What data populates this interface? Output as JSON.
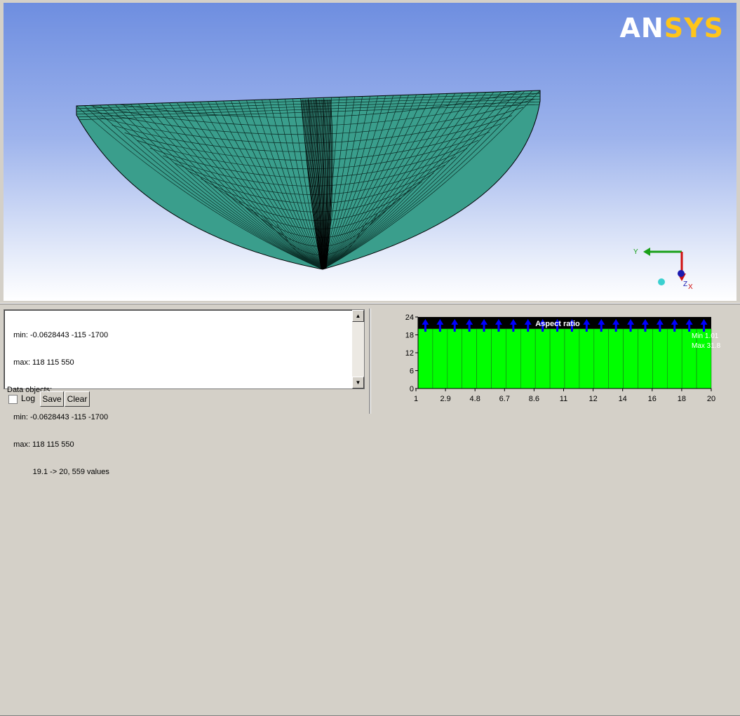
{
  "viewport": {
    "logo_part1": "AN",
    "logo_part2": "SYS",
    "triad": {
      "y_label": "Y",
      "z_label": "Z",
      "x_label": "X"
    }
  },
  "console": {
    "lines": [
      "   min: -0.0628443 -115 -1700",
      "   max: 118 115 550",
      "Data objects:",
      "   min: -0.0628443 -115 -1700",
      "   max: 118 115 550",
      "            19.1 -> 20, 559 values"
    ]
  },
  "controls": {
    "log_label": "Log",
    "save_label": "Save",
    "clear_label": "Clear"
  },
  "colors": {
    "mesh_fill": "#3a9e8c",
    "hist_bg": "#000000",
    "hist_bar": "#00ff00",
    "hist_marker": "#0000ff"
  },
  "chart_data": {
    "type": "bar",
    "title": "Aspect ratio",
    "x_ticks": [
      "1",
      "2.9",
      "4.8",
      "6.7",
      "8.6",
      "11",
      "12",
      "14",
      "16",
      "18",
      "20"
    ],
    "y_ticks": [
      "0",
      "6",
      "12",
      "18",
      "24"
    ],
    "ylim": [
      0,
      24
    ],
    "xlim": [
      1,
      20
    ],
    "bins": 20,
    "values": [
      20,
      20,
      20,
      20,
      20,
      20,
      20,
      20,
      20,
      20,
      20,
      20,
      20,
      20,
      20,
      20,
      20,
      20,
      20,
      20
    ],
    "min_label": "Min 1.01",
    "max_label": "Max 31.8"
  }
}
